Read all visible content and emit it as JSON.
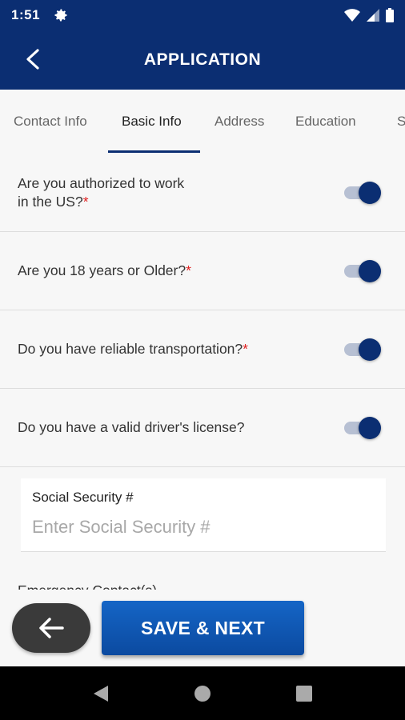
{
  "status_bar": {
    "time": "1:51"
  },
  "header": {
    "title": "APPLICATION"
  },
  "tabs": [
    {
      "label": "Contact Info",
      "active": false
    },
    {
      "label": "Basic Info",
      "active": true
    },
    {
      "label": "Address",
      "active": false
    },
    {
      "label": "Education",
      "active": false
    },
    {
      "label": "S",
      "active": false
    }
  ],
  "questions": [
    {
      "text": "Are you authorized to work in the US?",
      "required_mark": "*",
      "value": true
    },
    {
      "text": "Are you 18 years or Older?",
      "required_mark": "*",
      "value": true
    },
    {
      "text": "Do you have reliable transportation?",
      "required_mark": "*",
      "value": true
    },
    {
      "text": "Do you have a valid driver's license?",
      "required_mark": "",
      "value": true
    }
  ],
  "ssn": {
    "label": "Social Security #",
    "placeholder": "Enter Social Security #",
    "value": ""
  },
  "emergency": {
    "label": "Emergency Contact(s)"
  },
  "footer": {
    "save_label": "SAVE & NEXT"
  },
  "colors": {
    "primary": "#0b2e72",
    "button": "#1565c6",
    "required": "#e02020"
  }
}
